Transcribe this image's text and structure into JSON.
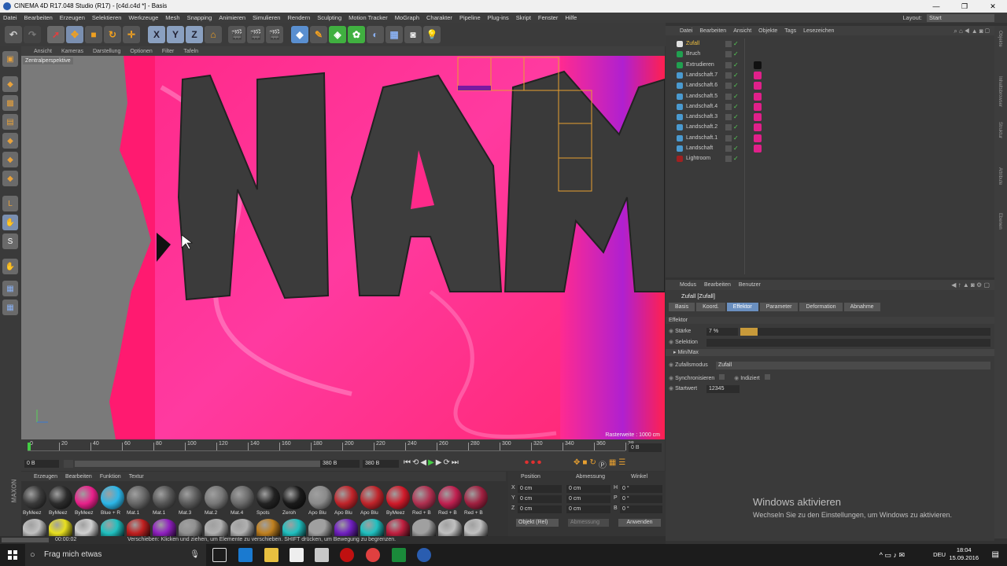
{
  "titlebar": {
    "title": "CINEMA 4D R17.048 Studio (R17) - [c4d.c4d *] - Basis",
    "min": "—",
    "max": "❐",
    "close": "✕"
  },
  "menubar": [
    "Datei",
    "Bearbeiten",
    "Erzeugen",
    "Selektieren",
    "Werkzeuge",
    "Mesh",
    "Snapping",
    "Animieren",
    "Simulieren",
    "Rendern",
    "Sculpting",
    "Motion Tracker",
    "MoGraph",
    "Charakter",
    "Pipeline",
    "Plug-ins",
    "Skript",
    "Fenster",
    "Hilfe"
  ],
  "layout": {
    "label": "Layout:",
    "value": "Start"
  },
  "viewport": {
    "menu": [
      "Ansicht",
      "Kameras",
      "Darstellung",
      "Optionen",
      "Filter",
      "Tafeln"
    ],
    "label": "Zentralperspektive",
    "raster": "Rasterweite : 1000 cm"
  },
  "timeline": {
    "ticks": [
      "0",
      "20",
      "40",
      "60",
      "80",
      "100",
      "120",
      "140",
      "160",
      "180",
      "200",
      "220",
      "240",
      "260",
      "280",
      "300",
      "320",
      "340",
      "360",
      "38"
    ],
    "frame_field": "0 B"
  },
  "transport": {
    "start": "0 B",
    "current": "0 B",
    "end1": "380 B",
    "end2": "380 B"
  },
  "materials": {
    "menu": [
      "Erzeugen",
      "Bearbeiten",
      "Funktion",
      "Textur"
    ],
    "row1": [
      {
        "label": "ByMeez",
        "color": "#3a3a3a"
      },
      {
        "label": "ByMeez",
        "color": "#2c2c2c"
      },
      {
        "label": "ByMeez",
        "color": "#e8208a"
      },
      {
        "label": "Blue + R",
        "color": "#2cb6e8"
      },
      {
        "label": "Mat.1",
        "color": "#666"
      },
      {
        "label": "Mat.1",
        "color": "#555"
      },
      {
        "label": "Mat.3",
        "color": "#5a5a5a"
      },
      {
        "label": "Mat.2",
        "color": "#777"
      },
      {
        "label": "Mat.4",
        "color": "#6a6a6a"
      },
      {
        "label": "Spots",
        "color": "#222"
      },
      {
        "label": "Zeroh",
        "color": "#1a1a1a"
      },
      {
        "label": "Apo Blu",
        "color": "#8a8a8a"
      },
      {
        "label": "Apo Blu",
        "color": "#c0242a"
      },
      {
        "label": "Apo Blu",
        "color": "#c0242a"
      },
      {
        "label": "ByMeez",
        "color": "#d01a2a"
      },
      {
        "label": "Red + B",
        "color": "#b03050"
      },
      {
        "label": "Red + B",
        "color": "#c02050"
      },
      {
        "label": "Red + B",
        "color": "#a02040"
      }
    ],
    "row2_colors": [
      "#c0c0c0",
      "#e8e020",
      "#d0d0d0",
      "#20c0c0",
      "#c02020",
      "#9020c0",
      "#909090",
      "#b0b0b0",
      "#b0b0b0",
      "#c08020",
      "#20c0c0",
      "#a0a0a0",
      "#7020c0",
      "#20c0c0",
      "#c02040",
      "#a0a0a0",
      "#c0c0c0",
      "#c0c0c0"
    ]
  },
  "coords": {
    "headers": [
      "Position",
      "Abmessung",
      "Winkel"
    ],
    "rows": [
      {
        "axis": "X",
        "pos": "0 cm",
        "dim": "0 cm",
        "ang_axis": "H",
        "ang": "0 °"
      },
      {
        "axis": "Y",
        "pos": "0 cm",
        "dim": "0 cm",
        "ang_axis": "P",
        "ang": "0 °"
      },
      {
        "axis": "Z",
        "pos": "0 cm",
        "dim": "0 cm",
        "ang_axis": "B",
        "ang": "0 °"
      }
    ],
    "mode": "Objekt (Rel)",
    "size_mode": "Abmessung",
    "apply": "Anwenden"
  },
  "statusbar": {
    "time": "00:00:02",
    "message": "Verschieben: Klicken und ziehen, um Elemente zu verschieben. SHIFT drücken, um Bewegung zu begrenzen."
  },
  "objmgr": {
    "menu": [
      "Datei",
      "Bearbeiten",
      "Ansicht",
      "Objekte",
      "Tags",
      "Lesezeichen"
    ],
    "objects": [
      {
        "name": "Zufall",
        "icon": "#e0e0e0",
        "selected": true,
        "tag": ""
      },
      {
        "name": "Bruch",
        "icon": "#20a050",
        "selected": false,
        "tag": ""
      },
      {
        "name": "Extrudieren",
        "icon": "#20a050",
        "selected": false,
        "tag": "#111"
      },
      {
        "name": "Landschaft.7",
        "icon": "#4a9ad0",
        "selected": false,
        "tag": "#e0208a"
      },
      {
        "name": "Landschaft.6",
        "icon": "#4a9ad0",
        "selected": false,
        "tag": "#e0208a"
      },
      {
        "name": "Landschaft.5",
        "icon": "#4a9ad0",
        "selected": false,
        "tag": "#e0208a"
      },
      {
        "name": "Landschaft.4",
        "icon": "#4a9ad0",
        "selected": false,
        "tag": "#e0208a"
      },
      {
        "name": "Landschaft.3",
        "icon": "#4a9ad0",
        "selected": false,
        "tag": "#e0208a"
      },
      {
        "name": "Landschaft.2",
        "icon": "#4a9ad0",
        "selected": false,
        "tag": "#e0208a"
      },
      {
        "name": "Landschaft.1",
        "icon": "#4a9ad0",
        "selected": false,
        "tag": "#e0208a"
      },
      {
        "name": "Landschaft",
        "icon": "#4a9ad0",
        "selected": false,
        "tag": "#e0208a"
      },
      {
        "name": "Lightroom",
        "icon": "#a02020",
        "selected": false,
        "tag": ""
      }
    ]
  },
  "attrmgr": {
    "menu": [
      "Modus",
      "Bearbeiten",
      "Benutzer"
    ],
    "title": "Zufall [Zufall]",
    "tabs": [
      {
        "label": "Basis",
        "active": false
      },
      {
        "label": "Koord.",
        "active": false
      },
      {
        "label": "Effektor",
        "active": true
      },
      {
        "label": "Parameter",
        "active": false
      },
      {
        "label": "Deformation",
        "active": false
      },
      {
        "label": "Abnahme",
        "active": false
      }
    ],
    "section": "Effektor",
    "strength_label": "Stärke",
    "strength_value": "7 %",
    "strength_fraction": 0.07,
    "selection_label": "Selektion",
    "minmax": "Min/Max",
    "mode_label": "Zufallsmodus",
    "mode_value": "Zufall",
    "sync_label": "Synchronisieren",
    "indexed_label": "Indiziert",
    "seed_label": "Startwert",
    "seed_value": "12345"
  },
  "windows_activation": {
    "title": "Windows aktivieren",
    "sub": "Wechseln Sie zu den Einstellungen, um Windows zu aktivieren."
  },
  "taskbar": {
    "search": "Frag mich etwas",
    "lang": "DEU",
    "time": "18:04",
    "date": "15.09.2016"
  },
  "right_strip": [
    "Objekte",
    "Inhaltsbrowser",
    "Struktur",
    "Attribute",
    "Ebenen"
  ]
}
